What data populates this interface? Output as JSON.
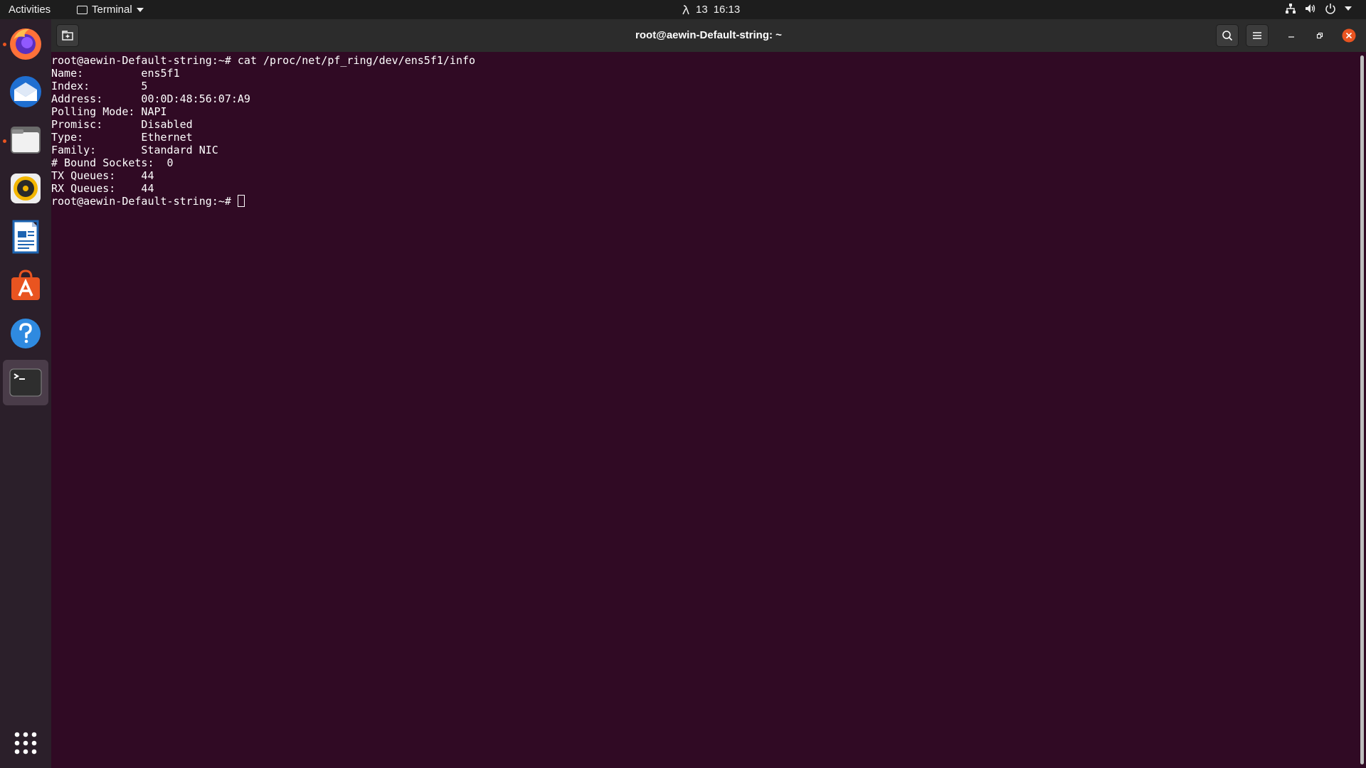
{
  "topbar": {
    "activities": "Activities",
    "app_name": "Terminal",
    "clock_prefix": "13",
    "time": "16:13"
  },
  "dock": {
    "apps": [
      {
        "name": "Firefox",
        "icon": "firefox-icon",
        "running": true
      },
      {
        "name": "Thunderbird",
        "icon": "thunderbird-icon",
        "running": false
      },
      {
        "name": "Files",
        "icon": "files-icon",
        "running": true
      },
      {
        "name": "Rhythmbox",
        "icon": "rhythmbox-icon",
        "running": false
      },
      {
        "name": "LibreOffice Writer",
        "icon": "writer-icon",
        "running": false
      },
      {
        "name": "Ubuntu Software",
        "icon": "software-icon",
        "running": false
      },
      {
        "name": "Help",
        "icon": "help-icon",
        "running": false
      },
      {
        "name": "Terminal",
        "icon": "terminal-icon",
        "running": true,
        "active": true
      }
    ],
    "show_apps_icon": "grid-icon"
  },
  "window": {
    "title": "root@aewin-Default-string: ~"
  },
  "terminal": {
    "lines": [
      "root@aewin-Default-string:~# cat /proc/net/pf_ring/dev/ens5f1/info",
      "Name:         ens5f1",
      "Index:        5",
      "Address:      00:0D:48:56:07:A9",
      "Polling Mode: NAPI",
      "Promisc:      Disabled",
      "Type:         Ethernet",
      "Family:       Standard NIC",
      "# Bound Sockets:  0",
      "TX Queues:    44",
      "RX Queues:    44"
    ],
    "prompt": "root@aewin-Default-string:~# "
  },
  "colors": {
    "terminal_bg": "#300a24",
    "accent": "#e95420"
  }
}
